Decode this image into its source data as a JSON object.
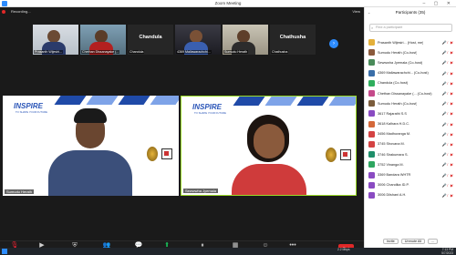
{
  "window": {
    "title": "Zoom Meeting",
    "controls": "– ▢ ✕"
  },
  "topbar": {
    "recording": "Recording...",
    "view_label": "View"
  },
  "thumbnails": [
    {
      "label": "Prasanth Wijesiri...",
      "type": "video"
    },
    {
      "label": "Chethan Dissanayake (...",
      "type": "video"
    },
    {
      "label": "Chandula",
      "type": "name"
    },
    {
      "label": "4369 Mallawarachchi...",
      "type": "video"
    },
    {
      "label": "Sumudu Herath",
      "type": "video"
    },
    {
      "label": "Chathusha",
      "type": "name"
    }
  ],
  "main_tiles": [
    {
      "brand": "INSPIRE",
      "tagline": "TO SHAPE YOUR FUTURE",
      "name": "Sumudu Herath"
    },
    {
      "brand": "INSPIRE",
      "tagline": "TO SHAPE YOUR FUTURE",
      "name": "Sewwwha Jyemala"
    }
  ],
  "toolbar": {
    "items": [
      "Unmute",
      "Stop Video",
      "Security",
      "Participants",
      "Chat",
      "Share Screen",
      "Pause/Stop Recording",
      "Breakout Rooms",
      "Reactions",
      "More"
    ],
    "end_label": "End"
  },
  "participants_panel": {
    "title": "Participants (35)",
    "search_placeholder": "Find a participant",
    "rows": [
      {
        "name": "Prasanth Wijesiri... (Host, me)",
        "color": "#e4b03b"
      },
      {
        "name": "Sumudu Herath (Co-host)",
        "color": "#8b5a3c"
      },
      {
        "name": "Sewwwha Jyemala (Co-host)",
        "color": "#4a8b5a"
      },
      {
        "name": "4369 Mallawarachchi... (Co-host)",
        "color": "#3a6ea8"
      },
      {
        "name": "Chandula (Co-host)",
        "color": "#2fae5d"
      },
      {
        "name": "Chethan Dissanayake (... (Co-host)",
        "color": "#c54a8b"
      },
      {
        "name": "Sumudu Herath (Co-host)",
        "color": "#7b5c3c"
      },
      {
        "name": "3617 Rajarathi S.S",
        "color": "#8a4bc2"
      },
      {
        "name": "3618 Kalhara H.D.C.",
        "color": "#d4683a"
      },
      {
        "name": "3456 Madhuranga M.",
        "color": "#d44343"
      },
      {
        "name": "3745 Shovana M.",
        "color": "#d44343"
      },
      {
        "name": "3746 Sirakumara S.",
        "color": "#1f8f6a"
      },
      {
        "name": "3752 Vinanga M.",
        "color": "#2ea660"
      },
      {
        "name": "3369 Bandara WHTR",
        "color": "#8a4bc2"
      },
      {
        "name": "3006 Chandika ID.P.",
        "color": "#8a4bc2"
      },
      {
        "name": "3006 Dilshani A.H.",
        "color": "#8a4bc2"
      }
    ],
    "footer": [
      "Invite",
      "Unmute All",
      "..."
    ]
  },
  "taskbar": {
    "weather": "2.2 Mbps",
    "time": "7:13 PM",
    "date": "5/7/2023"
  }
}
